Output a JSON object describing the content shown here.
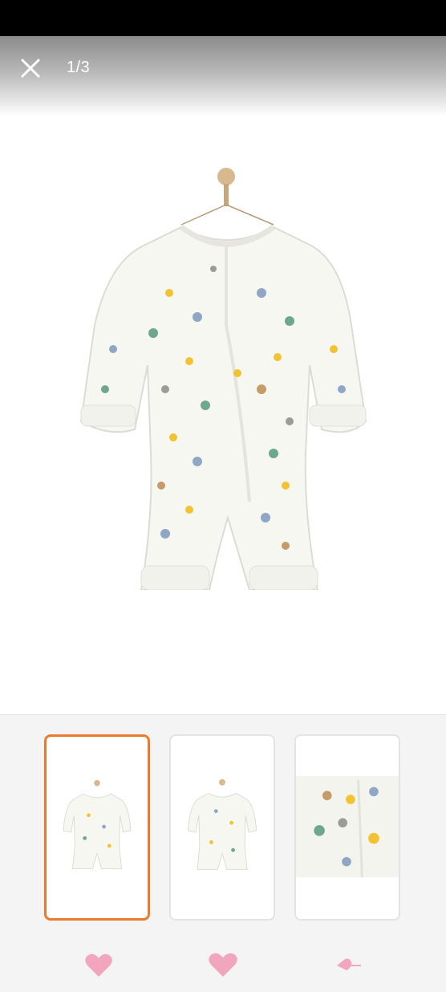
{
  "viewer": {
    "counter": "1/3",
    "close_icon": "close-icon",
    "current_index": 1,
    "total": 3
  },
  "product": {
    "main_image": "baby-romper-long-sleeve-animal-print-on-hanger"
  },
  "thumbnails": [
    {
      "image": "romper-front-small",
      "selected": true
    },
    {
      "image": "romper-front-alt",
      "selected": false
    },
    {
      "image": "romper-fabric-closeup",
      "selected": false
    }
  ],
  "bottom_icons": [
    "heart-icon",
    "heart-icon",
    "heart-icon"
  ],
  "colors": {
    "selected_border": "#ec7a2d",
    "heart": "#f2a6bd",
    "strip_bg": "#f4f4f4",
    "status_bar": "#000000"
  }
}
